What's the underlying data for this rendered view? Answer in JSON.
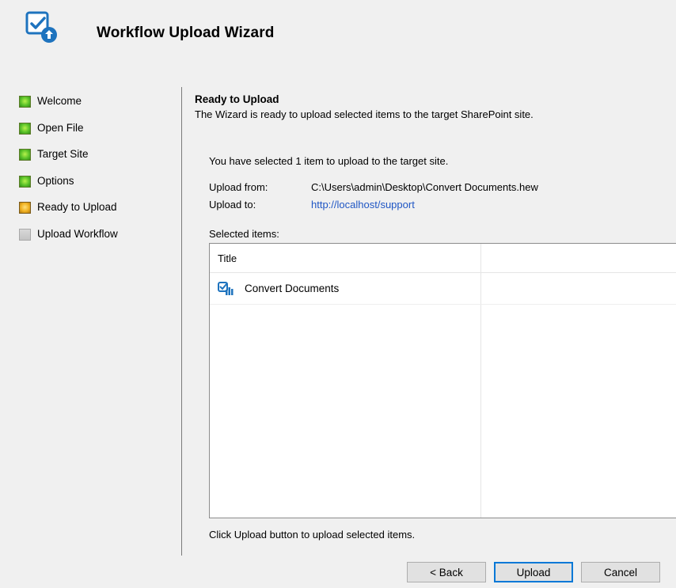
{
  "header": {
    "title": "Workflow Upload Wizard",
    "icon": "workflow-upload-icon"
  },
  "steps": [
    {
      "label": "Welcome",
      "state": "done"
    },
    {
      "label": "Open File",
      "state": "done"
    },
    {
      "label": "Target Site",
      "state": "done"
    },
    {
      "label": "Options",
      "state": "done"
    },
    {
      "label": "Ready to Upload",
      "state": "current"
    },
    {
      "label": "Upload Workflow",
      "state": "pending"
    }
  ],
  "main": {
    "title": "Ready to Upload",
    "description": "The Wizard is ready to upload selected items to the target SharePoint site.",
    "summary": "You have selected 1 item to upload to the target site.",
    "upload_from_label": "Upload from:",
    "upload_from_value": "C:\\Users\\admin\\Desktop\\Convert Documents.hew",
    "upload_to_label": "Upload to:",
    "upload_to_value": "http://localhost/support",
    "selected_items_label": "Selected items:",
    "table": {
      "columns": [
        "Title",
        ""
      ],
      "rows": [
        {
          "title": "Convert Documents",
          "icon": "workflow-icon"
        }
      ]
    },
    "hint": "Click Upload button to upload selected items."
  },
  "buttons": {
    "back": "< Back",
    "upload": "Upload",
    "cancel": "Cancel"
  },
  "colors": {
    "link": "#1f56c4",
    "step_done": "#5bc22a",
    "step_current": "#f0b020",
    "step_pending": "#c4c4c4",
    "icon_blue": "#1e73be"
  }
}
